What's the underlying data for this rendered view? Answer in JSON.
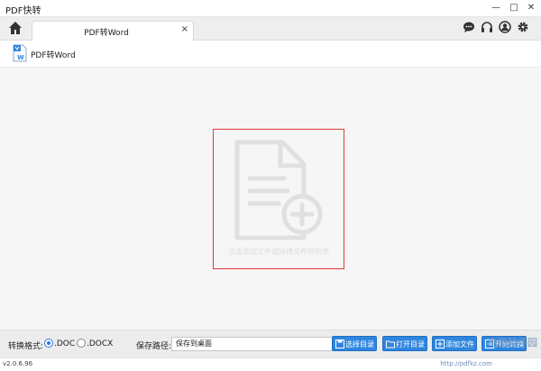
{
  "window": {
    "title": "PDF快转",
    "controls": {
      "minimize": "—",
      "maximize": "□",
      "close": "✕"
    }
  },
  "tabbar": {
    "home_icon": "home-icon",
    "tabs": [
      {
        "label": "PDF转Word",
        "close": "×"
      }
    ],
    "tools": [
      "chat-icon",
      "headset-icon",
      "user-icon",
      "gear-icon"
    ]
  },
  "subheader": {
    "icon": "word-file-icon",
    "label": "PDF转Word"
  },
  "dropzone": {
    "icon": "add-file-icon",
    "hint": "点击添加文件或拖拽文件到列表"
  },
  "bottombar": {
    "format_label": "转换格式:",
    "formats": [
      {
        "label": ".DOC",
        "selected": true
      },
      {
        "label": ".DOCX",
        "selected": false
      }
    ],
    "path_label": "保存路径:",
    "path_value": "保存到桌面",
    "buttons": {
      "choose_dir": "选择目录",
      "open_dir": "打开目录",
      "add_file": "添加文件",
      "start": "开始转换"
    }
  },
  "status": {
    "version": "v2.0.6.96",
    "url": "http://pdfkz.com"
  },
  "watermark": "电脑软件园",
  "colors": {
    "accent": "#2f86df",
    "dropzone_border": "#e03a3a",
    "icon_gray": "#e0e0e0"
  }
}
